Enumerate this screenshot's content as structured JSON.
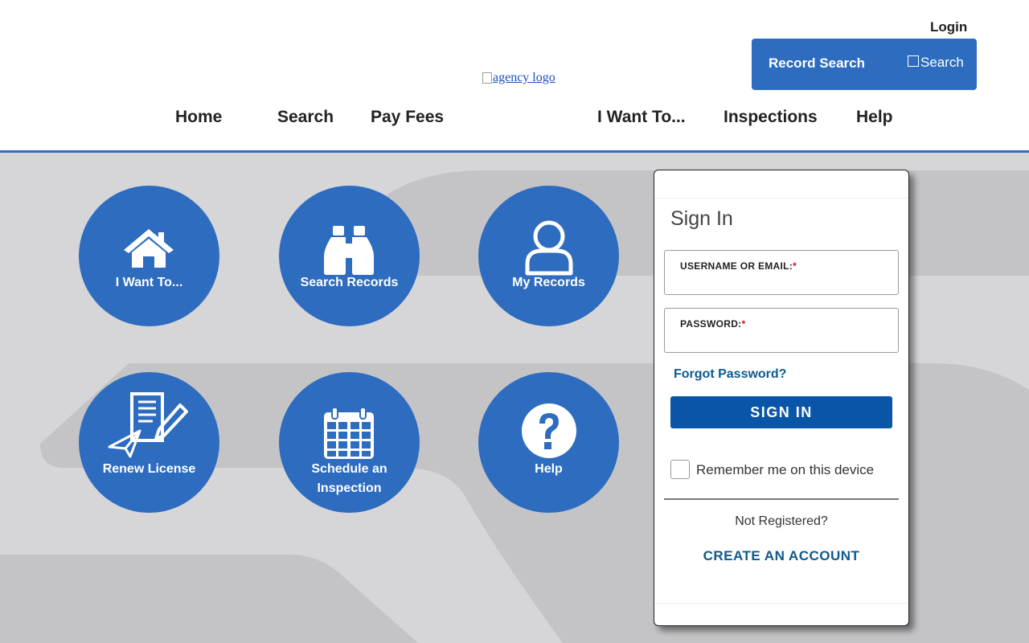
{
  "header": {
    "login_label": "Login",
    "record_search_label": "Record Search",
    "search_button_label": "Search",
    "logo_alt": "agency logo"
  },
  "nav": {
    "items": [
      {
        "label": "Home"
      },
      {
        "label": "Search"
      },
      {
        "label": "Pay Fees"
      },
      {
        "label": "I Want To..."
      },
      {
        "label": "Inspections"
      },
      {
        "label": "Help"
      }
    ]
  },
  "tiles": [
    {
      "label": "I Want To...",
      "icon": "house-icon"
    },
    {
      "label": "Search Records",
      "icon": "binoculars-icon"
    },
    {
      "label": "My Records",
      "icon": "person-icon"
    },
    {
      "label": "Renew License",
      "icon": "document-pen-plane-icon"
    },
    {
      "label_line1": "Schedule an",
      "label_line2": "Inspection",
      "icon": "calendar-icon"
    },
    {
      "label": "Help",
      "icon": "question-icon"
    }
  ],
  "signin": {
    "title": "Sign In",
    "username_label": "USERNAME OR EMAIL:",
    "password_label": "PASSWORD:",
    "required_marker": "*",
    "forgot_password": "Forgot Password?",
    "signin_button": "SIGN IN",
    "remember_me": "Remember me on this device",
    "not_registered": "Not Registered?",
    "create_account": "CREATE AN ACCOUNT"
  },
  "colors": {
    "brand_blue": "#2d6cbf",
    "button_blue": "#0a55a8",
    "link_blue": "#0d5a8c",
    "background_gray": "#d6d6d8",
    "required_red": "#c8102e"
  }
}
